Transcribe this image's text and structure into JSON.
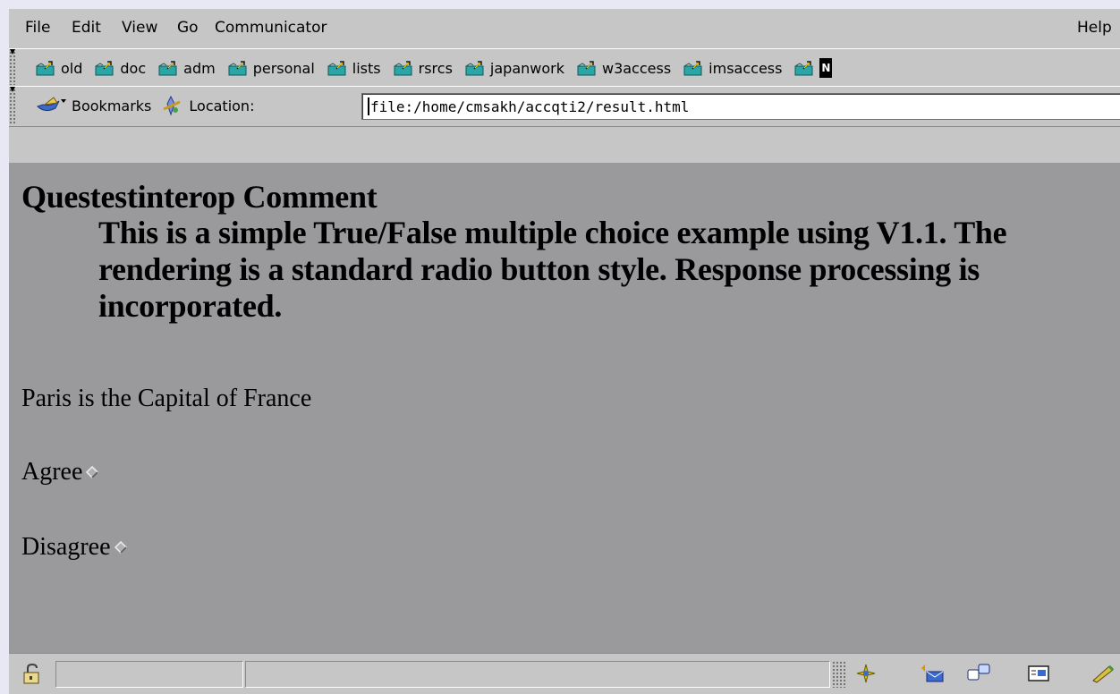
{
  "menubar": {
    "items": [
      "File",
      "Edit",
      "View",
      "Go",
      "Communicator"
    ],
    "help": "Help"
  },
  "personal_toolbar": {
    "items": [
      "old",
      "doc",
      "adm",
      "personal",
      "lists",
      "rsrcs",
      "japanwork",
      "w3access",
      "imsaccess"
    ]
  },
  "location_bar": {
    "bookmarks_label": "Bookmarks",
    "location_label": "Location:",
    "url": "file:/home/cmsakh/accqti2/result.html"
  },
  "content": {
    "title": "Questestinterop Comment",
    "description": "This is a simple True/False multiple choice example using V1.1. The rendering is a standard radio button style. Response processing is incorporated.",
    "question": "Paris is the Capital of France",
    "choices": [
      "Agree",
      "Disagree"
    ]
  },
  "status": {
    "message": "",
    "progress": ""
  },
  "colors": {
    "chrome": "#c6c6c6",
    "content_bg": "#9a999b",
    "outer_bg": "#e8e8f4",
    "folder_icon_teal": "#2aa6a6"
  },
  "icons": {
    "bookmark_folder": "folder-icon",
    "bookmarks": "bookmarks-icon",
    "location": "location-icon",
    "security": "lock-icon",
    "taskbar": [
      "navigator-icon",
      "mail-icon",
      "discussion-icon",
      "composer-icon",
      "addressbook-icon"
    ]
  }
}
